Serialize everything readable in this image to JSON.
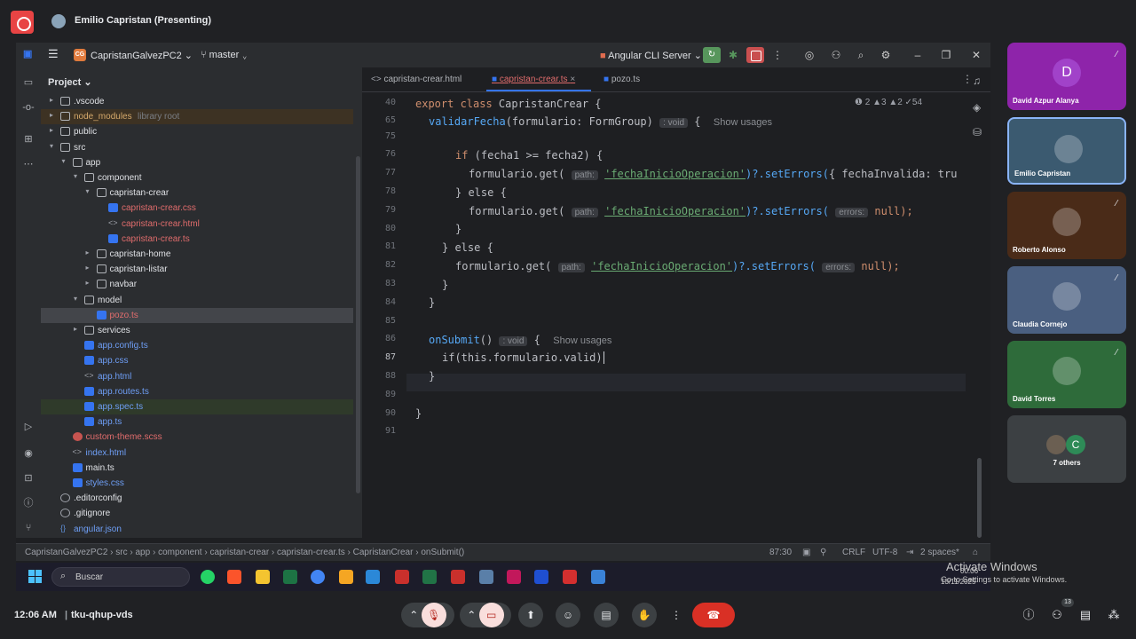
{
  "meet": {
    "presenter_label": "Emilio Capristan (Presenting)",
    "time": "12:06 AM",
    "separator": "|",
    "meeting_code": "tku-qhup-vds",
    "participants_count": "13"
  },
  "ide": {
    "project_name": "CapristanGalvezPC2",
    "project_badge": "CG",
    "branch": "master",
    "run_config": "Angular CLI Server",
    "project_panel_title": "Project",
    "tree": [
      {
        "label": ".vscode",
        "depth": 1,
        "kind": "folder",
        "arrow": "›"
      },
      {
        "label": "node_modules",
        "depth": 1,
        "kind": "folder",
        "arrow": "›",
        "note": "library root"
      },
      {
        "label": "public",
        "depth": 1,
        "kind": "folder",
        "arrow": "›"
      },
      {
        "label": "src",
        "depth": 1,
        "kind": "folder",
        "arrow": "⌄"
      },
      {
        "label": "app",
        "depth": 2,
        "kind": "folder",
        "arrow": "⌄"
      },
      {
        "label": "component",
        "depth": 3,
        "kind": "folder",
        "arrow": "⌄"
      },
      {
        "label": "capristan-crear",
        "depth": 4,
        "kind": "folder",
        "arrow": "⌄"
      },
      {
        "label": "capristan-crear.css",
        "depth": 5,
        "kind": "css"
      },
      {
        "label": "capristan-crear.html",
        "depth": 5,
        "kind": "html"
      },
      {
        "label": "capristan-crear.ts",
        "depth": 5,
        "kind": "ts"
      },
      {
        "label": "capristan-home",
        "depth": 4,
        "kind": "folder",
        "arrow": "›"
      },
      {
        "label": "capristan-listar",
        "depth": 4,
        "kind": "folder",
        "arrow": "›"
      },
      {
        "label": "navbar",
        "depth": 4,
        "kind": "folder",
        "arrow": "›"
      },
      {
        "label": "model",
        "depth": 3,
        "kind": "folder",
        "arrow": "⌄"
      },
      {
        "label": "pozo.ts",
        "depth": 4,
        "kind": "ts"
      },
      {
        "label": "services",
        "depth": 3,
        "kind": "folder",
        "arrow": "›"
      },
      {
        "label": "app.config.ts",
        "depth": 3,
        "kind": "ts"
      },
      {
        "label": "app.css",
        "depth": 3,
        "kind": "css"
      },
      {
        "label": "app.html",
        "depth": 3,
        "kind": "html"
      },
      {
        "label": "app.routes.ts",
        "depth": 3,
        "kind": "ts"
      },
      {
        "label": "app.spec.ts",
        "depth": 3,
        "kind": "ts"
      },
      {
        "label": "app.ts",
        "depth": 3,
        "kind": "ts"
      },
      {
        "label": "custom-theme.scss",
        "depth": 2,
        "kind": "scss"
      },
      {
        "label": "index.html",
        "depth": 2,
        "kind": "html"
      },
      {
        "label": "main.ts",
        "depth": 2,
        "kind": "ts"
      },
      {
        "label": "styles.css",
        "depth": 2,
        "kind": "css"
      },
      {
        "label": ".editorconfig",
        "depth": 1,
        "kind": "cfg"
      },
      {
        "label": ".gitignore",
        "depth": 1,
        "kind": "cfg"
      },
      {
        "label": "angular.json",
        "depth": 1,
        "kind": "json"
      }
    ],
    "tabs": [
      {
        "label": "capristan-crear.html"
      },
      {
        "label": "capristan-crear.ts"
      },
      {
        "label": "pozo.ts"
      }
    ],
    "inspections": "❶ 2  ▲3  ▲2  ✓54",
    "line_numbers": [
      "40",
      "65",
      "75",
      "76",
      "77",
      "78",
      "79",
      "80",
      "81",
      "82",
      "83",
      "84",
      "85",
      "86",
      "87",
      "88",
      "89",
      "90",
      "91"
    ],
    "code": {
      "l40_kw": "export class ",
      "l40_name": "CapristanCrear",
      "l40_rest": " {",
      "l65_fn": "validarFecha",
      "l65_args": "(formulario: FormGroup)",
      "l65_hint": ": void",
      "l65_brace": " {",
      "l65_usages": "Show usages",
      "l76_kw": "if",
      "l76_rest": " (fecha1 >= fecha2) {",
      "get_call": "formulario.get(",
      "path_hint": "path:",
      "path_str": "'fechaInicioOperacion'",
      "set_errors": ")?.setErrors(",
      "l77_tail": "{ fechaInvalida: tru",
      "l78": "} else {",
      "errors_hint": "errors:",
      "null_end": "null);",
      "l80": "}",
      "l81": "} else {",
      "l83": "}",
      "l84": "}",
      "l86_fn": "onSubmit",
      "l86_parens": "()",
      "l86_hint": ": void",
      "l86_brace": " {",
      "l86_usages": "Show usages",
      "l87": "if(this.formulario.valid)",
      "l88": "}",
      "l90": "}"
    },
    "status": {
      "breadcrumbs": [
        "CapristanGalvezPC2",
        "src",
        "app",
        "component",
        "capristan-crear",
        "capristan-crear.ts",
        "CapristanCrear",
        "onSubmit()"
      ],
      "position": "87:30",
      "line_sep": "CRLF",
      "encoding": "UTF-8",
      "indent": "2 spaces*"
    }
  },
  "taskbar": {
    "search": "Buscar",
    "time": "00:06",
    "date": "13/11/2025"
  },
  "activate": {
    "title": "Activate Windows",
    "subtitle": "Go to Settings to activate Windows."
  },
  "participants": [
    {
      "name": "David Azpur Alanya",
      "initial": "D",
      "bg": "#8e24aa",
      "muted": true
    },
    {
      "name": "Emilio Capristan",
      "initial": "",
      "bg": "#3b5a70",
      "muted": false
    },
    {
      "name": "Roberto Alonso",
      "initial": "",
      "bg": "#4a2b18",
      "muted": true
    },
    {
      "name": "Claudia Cornejo",
      "initial": "",
      "bg": "#4a5f80",
      "muted": true
    },
    {
      "name": "David Torres",
      "initial": "",
      "bg": "#2e6b3a",
      "muted": true
    },
    {
      "name": "7 others",
      "initial": "C",
      "bg": "#3c4043"
    }
  ],
  "colors": {
    "accent": "#3574f0",
    "end_call": "#d93025"
  }
}
